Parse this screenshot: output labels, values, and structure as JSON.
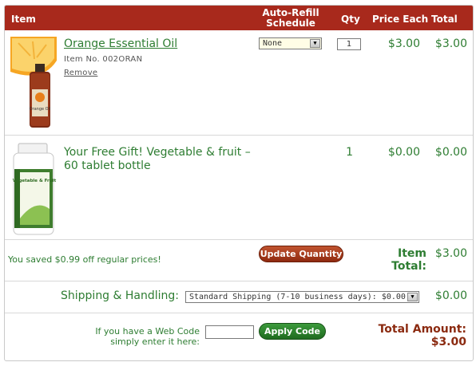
{
  "header": {
    "item": "Item",
    "auto_refill": "Auto-Refill Schedule",
    "qty": "Qty",
    "price_each": "Price Each",
    "total": "Total"
  },
  "items": [
    {
      "name": "Orange Essential Oil",
      "item_no": "Item No. 002ORAN",
      "remove": "Remove",
      "refill": "None",
      "qty": "1",
      "price": "$3.00",
      "total": "$3.00",
      "bottle_label": "Orange Oil"
    },
    {
      "name": "Your Free Gift! Vegetable & fruit – 60 tablet bottle",
      "qty": "1",
      "price": "$0.00",
      "total": "$0.00",
      "bottle_label": "Vegetable & Fruit"
    }
  ],
  "summary": {
    "saved_text": "You saved $0.99 off regular prices!",
    "update_button": "Update Quantity",
    "item_total_label": "Item Total:",
    "item_total": "$3.00"
  },
  "shipping": {
    "label": "Shipping & Handling:",
    "option": "Standard Shipping (7-10 business days): $0.00",
    "amount": "$0.00"
  },
  "webcode": {
    "label_line1": "If you have a Web Code",
    "label_line2": "simply enter it here:",
    "value": "",
    "apply_button": "Apply Code"
  },
  "grand_total": {
    "label": "Total Amount:",
    "amount": "$3.00"
  },
  "colors": {
    "header_bg": "#a8291c",
    "text_green": "#2e7d32",
    "total_label": "#8b2a10"
  }
}
